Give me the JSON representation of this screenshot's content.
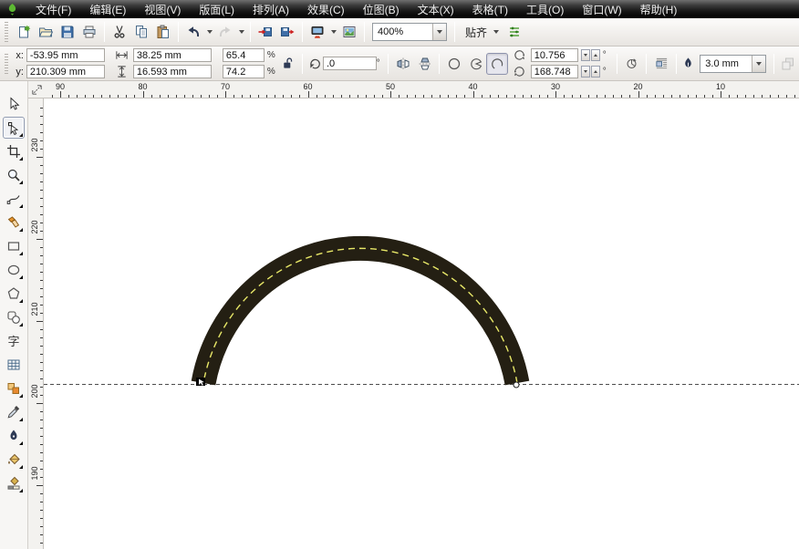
{
  "menu": {
    "logo_icon": "corel-logo",
    "items": [
      "文件(F)",
      "编辑(E)",
      "视图(V)",
      "版面(L)",
      "排列(A)",
      "效果(C)",
      "位图(B)",
      "文本(X)",
      "表格(T)",
      "工具(O)",
      "窗口(W)",
      "帮助(H)"
    ]
  },
  "toolbar": {
    "buttons": [
      {
        "name": "new",
        "icon": "new-document"
      },
      {
        "name": "open",
        "icon": "open-folder"
      },
      {
        "name": "save",
        "icon": "save"
      },
      {
        "name": "print",
        "icon": "print"
      },
      {
        "sep": true
      },
      {
        "name": "cut",
        "icon": "cut"
      },
      {
        "name": "copy",
        "icon": "copy"
      },
      {
        "name": "paste",
        "icon": "paste"
      },
      {
        "sep": true
      },
      {
        "name": "undo",
        "icon": "undo",
        "caret": true
      },
      {
        "name": "redo",
        "icon": "redo",
        "caret": true,
        "disabled": true
      },
      {
        "sep": true
      },
      {
        "name": "import",
        "icon": "import"
      },
      {
        "name": "export",
        "icon": "export"
      },
      {
        "sep": true
      },
      {
        "name": "application-launcher",
        "icon": "app-launcher",
        "caret": true
      },
      {
        "name": "welcome-screen",
        "icon": "welcome-screen"
      },
      {
        "sep": true
      }
    ],
    "zoom_combo_value": "400%",
    "snap_label": "贴齐",
    "options_icon": "options"
  },
  "property_bar": {
    "x_label": "x:",
    "x_value": "-53.95 mm",
    "y_label": "y:",
    "y_value": "210.309 mm",
    "width_value": "38.25 mm",
    "height_value": "16.593 mm",
    "scale_h_value": "65.4",
    "scale_v_value": "74.2",
    "percent": "%",
    "rotation_value": ".0",
    "degree": "°",
    "start_angle_value": "10.756",
    "end_angle_value": "168.748",
    "outline_width_value": "3.0 mm"
  },
  "rulers": {
    "horizontal_labels": [
      "90",
      "80",
      "70",
      "60",
      "50",
      "40",
      "30",
      "20",
      "10"
    ],
    "vertical_labels": [
      "230",
      "220",
      "210",
      "200",
      "190"
    ]
  },
  "toolbox": {
    "text_glyph": "字",
    "tools": [
      {
        "name": "pick",
        "icon": "pick"
      },
      {
        "name": "shape",
        "icon": "shape",
        "selected": true,
        "flyout": true
      },
      {
        "name": "crop",
        "icon": "crop",
        "flyout": true
      },
      {
        "name": "zoom",
        "icon": "zoomtool",
        "flyout": true
      },
      {
        "name": "freehand",
        "icon": "freehand",
        "flyout": true
      },
      {
        "name": "smart-fill",
        "icon": "smartfill",
        "flyout": true
      },
      {
        "name": "rectangle",
        "icon": "recttool",
        "flyout": true
      },
      {
        "name": "ellipse",
        "icon": "ellipsetool",
        "flyout": true
      },
      {
        "name": "polygon",
        "icon": "polygontool",
        "flyout": true
      },
      {
        "name": "basic-shapes",
        "icon": "basicshapes",
        "flyout": true
      },
      {
        "name": "text",
        "icon": "text"
      },
      {
        "name": "table",
        "icon": "tabletool"
      },
      {
        "name": "blend",
        "icon": "blendtool",
        "flyout": true
      },
      {
        "name": "eyedropper",
        "icon": "eyedropper",
        "flyout": true
      },
      {
        "name": "outline-pen",
        "icon": "outlinepen",
        "flyout": true
      },
      {
        "name": "fill",
        "icon": "filltool",
        "flyout": true
      },
      {
        "name": "interactive-fill",
        "icon": "interactivefill",
        "flyout": true
      }
    ]
  },
  "canvas": {
    "background": "#ffffff",
    "arc_color": "#241f13",
    "centerline_color": "#e8e868",
    "guideline_color": "#4d4d4d"
  }
}
